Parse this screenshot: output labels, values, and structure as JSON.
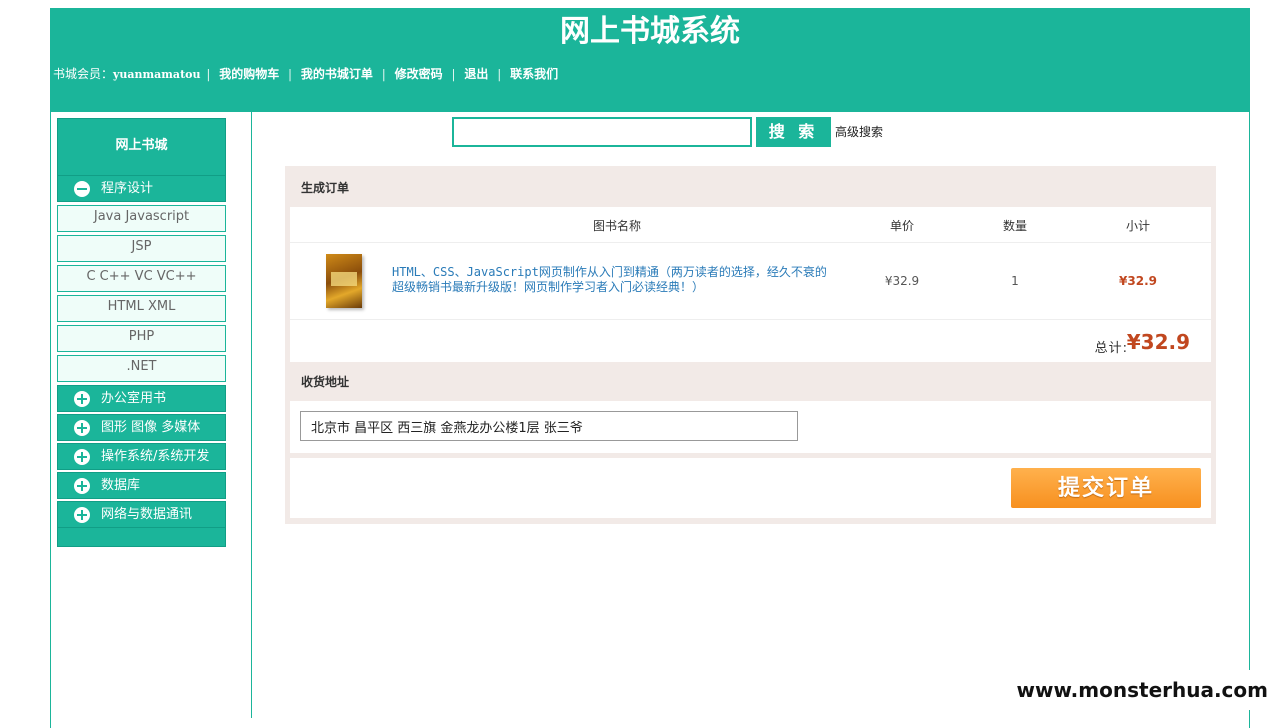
{
  "header": {
    "title": "网上书城系统",
    "member_label": "书城会员：",
    "member_name": "yuanmamatou",
    "nav": [
      "我的购物车",
      "我的书城订单",
      "修改密码",
      "退出",
      "联系我们"
    ]
  },
  "sidebar": {
    "title": "网上书城",
    "expanded_category": "程序设计",
    "subcategories": [
      "Java Javascript",
      "JSP",
      "C C++ VC VC++",
      "HTML XML",
      "PHP",
      ".NET"
    ],
    "categories": [
      "办公室用书",
      "图形 图像 多媒体",
      "操作系统/系统开发",
      "数据库",
      "网络与数据通讯"
    ]
  },
  "search": {
    "value": "",
    "button_label": "搜 索",
    "advanced_label": "高级搜索"
  },
  "order": {
    "section_title": "生成订单",
    "columns": [
      "图书名称",
      "单价",
      "数量",
      "小计"
    ],
    "items": [
      {
        "name": "HTML、CSS、JavaScript网页制作从入门到精通（两万读者的选择，经久不衰的超级畅销书最新升级版！网页制作学习者入门必读经典！）",
        "unit_price": "¥32.9",
        "quantity": "1",
        "subtotal": "¥32.9"
      }
    ],
    "total_label": "总计:",
    "total_value": "¥32.9"
  },
  "address": {
    "section_title": "收货地址",
    "value": "北京市 昌平区 西三旗 金燕龙办公楼1层 张三爷"
  },
  "submit": {
    "label": "提交订单"
  },
  "watermark": "www.monsterhua.com",
  "colors": {
    "primary": "#1bb59a",
    "panel_bg": "#f2eae7",
    "price": "#c1471f",
    "submit": "#f7901f",
    "link": "#2a7bb8"
  }
}
